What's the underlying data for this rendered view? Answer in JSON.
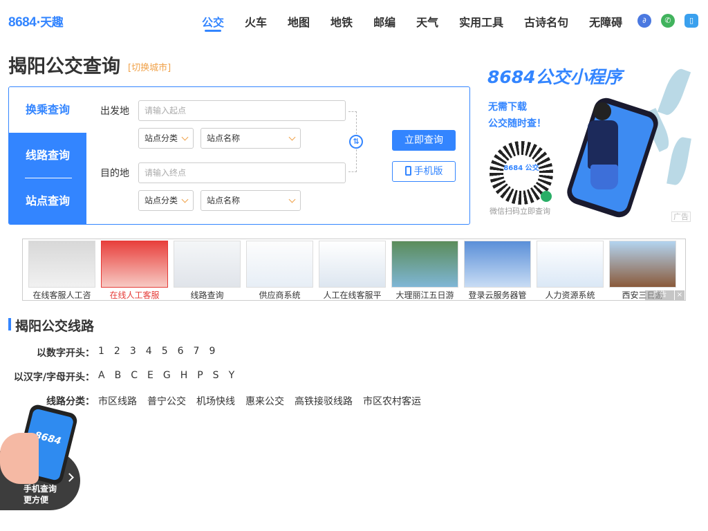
{
  "header": {
    "logo_num": "8684",
    "logo_cn": "·天趣",
    "nav": [
      "公交",
      "火车",
      "地图",
      "地铁",
      "邮编",
      "天气",
      "实用工具",
      "古诗名句",
      "无障碍"
    ]
  },
  "page": {
    "title": "揭阳公交查询",
    "switch_city": "[切换城市]"
  },
  "query": {
    "tabs": {
      "transfer": "换乘查询",
      "line": "线路查询",
      "station": "站点查询"
    },
    "from_label": "出发地",
    "to_label": "目的地",
    "from_placeholder": "请输入起点",
    "to_placeholder": "请输入终点",
    "category_select": "站点分类",
    "name_select": "站点名称",
    "query_button": "立即查询",
    "mobile_button": "手机版"
  },
  "ad_right": {
    "title": "8684公交小程序",
    "line1": "无需下载",
    "line2": "公交随时查！",
    "qr_text": "8684 公交",
    "caption": "微信扫码立即查询",
    "tag": "广告"
  },
  "ad_strip": {
    "items": [
      {
        "label": "在线客服人工咨"
      },
      {
        "label": "在线人工客服"
      },
      {
        "label": "线路查询"
      },
      {
        "label": "供应商系统"
      },
      {
        "label": "人工在线客服平"
      },
      {
        "label": "大理丽江五日游"
      },
      {
        "label": "登录云服务器管"
      },
      {
        "label": "人力资源系统"
      },
      {
        "label": "西安三日游"
      }
    ],
    "tag": "广告",
    "close": "×"
  },
  "section": {
    "title": "揭阳公交线路",
    "rows": [
      {
        "label": "以数字开头：",
        "items": [
          "1",
          "2",
          "3",
          "4",
          "5",
          "6",
          "7",
          "9"
        ]
      },
      {
        "label": "以汉字/字母开头：",
        "items": [
          "A",
          "B",
          "C",
          "E",
          "G",
          "H",
          "P",
          "S",
          "Y"
        ]
      },
      {
        "label": "线路分类：",
        "items": [
          "市区线路",
          "普宁公交",
          "机场快线",
          "惠来公交",
          "高铁接驳线路",
          "市区农村客运"
        ]
      }
    ]
  },
  "float": {
    "phone_text": "8684",
    "line1": "手机查询",
    "line2": "更方便"
  }
}
